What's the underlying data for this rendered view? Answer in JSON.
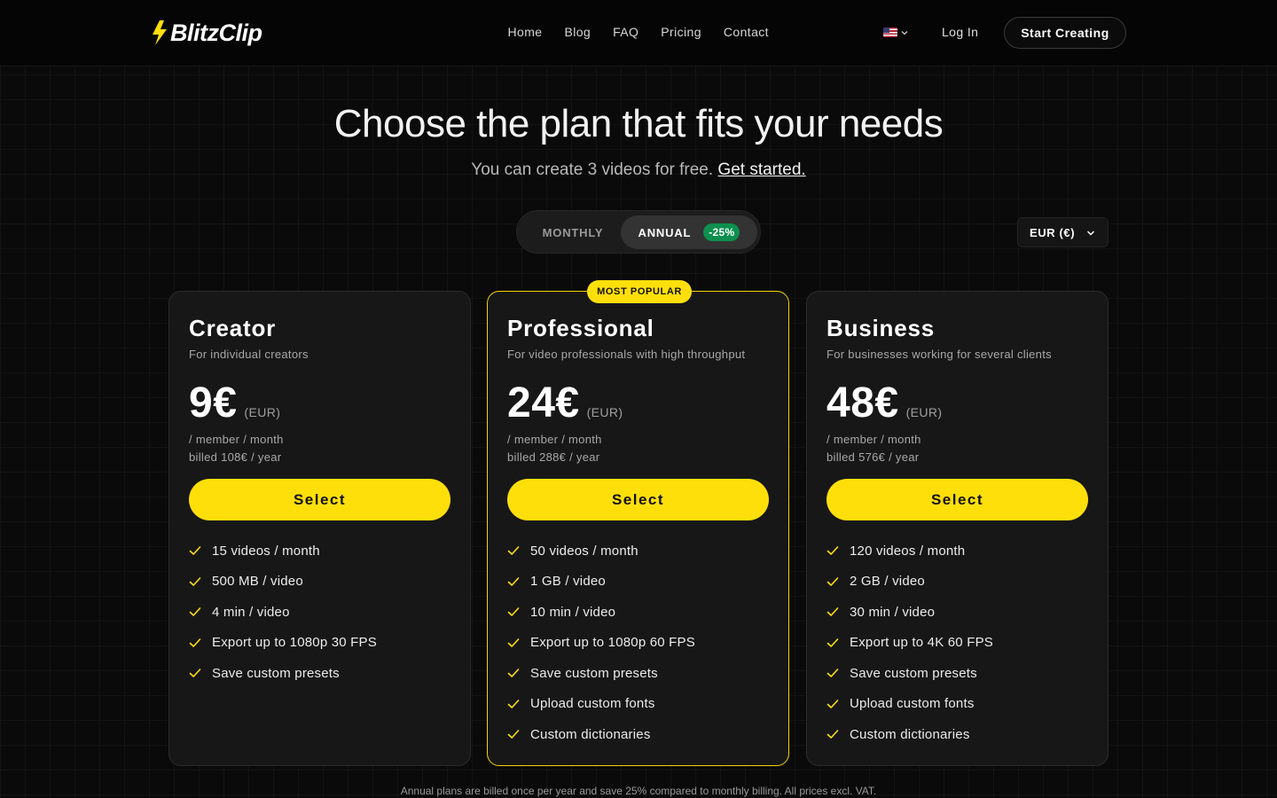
{
  "brand": {
    "name": "BlitzClip",
    "accent": "#FFDF0A"
  },
  "nav": {
    "links": [
      "Home",
      "Blog",
      "FAQ",
      "Pricing",
      "Contact"
    ],
    "language_icon": "us-flag-icon",
    "login": "Log In",
    "cta": "Start Creating"
  },
  "hero": {
    "title": "Choose the plan that fits your needs",
    "subtitle": "You can create 3 videos for free.",
    "subtitle_link": "Get started."
  },
  "billing_toggle": {
    "monthly": "MONTHLY",
    "annual": "ANNUAL",
    "annual_badge": "-25%",
    "selected": "ANNUAL"
  },
  "currency": {
    "selected": "EUR (€)"
  },
  "plans": [
    {
      "name": "Creator",
      "description": "For individual creators",
      "price": "9€",
      "currency": "(EUR)",
      "per": "/ member / month",
      "billed": "billed 108€ / year",
      "button": "Select",
      "features": [
        "15 videos / month",
        "500 MB / video",
        "4 min / video",
        "Export up to 1080p 30 FPS",
        "Save custom presets"
      ]
    },
    {
      "name": "Professional",
      "badge": "MOST POPULAR",
      "description": "For video professionals with high throughput",
      "price": "24€",
      "currency": "(EUR)",
      "per": "/ member / month",
      "billed": "billed 288€ / year",
      "button": "Select",
      "features": [
        "50 videos / month",
        "1 GB / video",
        "10 min / video",
        "Export up to 1080p 60 FPS",
        "Save custom presets",
        "Upload custom fonts",
        "Custom dictionaries"
      ]
    },
    {
      "name": "Business",
      "description": "For businesses working for several clients",
      "price": "48€",
      "currency": "(EUR)",
      "per": "/ member / month",
      "billed": "billed 576€ / year",
      "button": "Select",
      "features": [
        "120 videos / month",
        "2 GB / video",
        "30 min / video",
        "Export up to 4K 60 FPS",
        "Save custom presets",
        "Upload custom fonts",
        "Custom dictionaries"
      ]
    }
  ],
  "footnote": "Annual plans are billed once per year and save 25% compared to monthly billing. All prices excl. VAT."
}
